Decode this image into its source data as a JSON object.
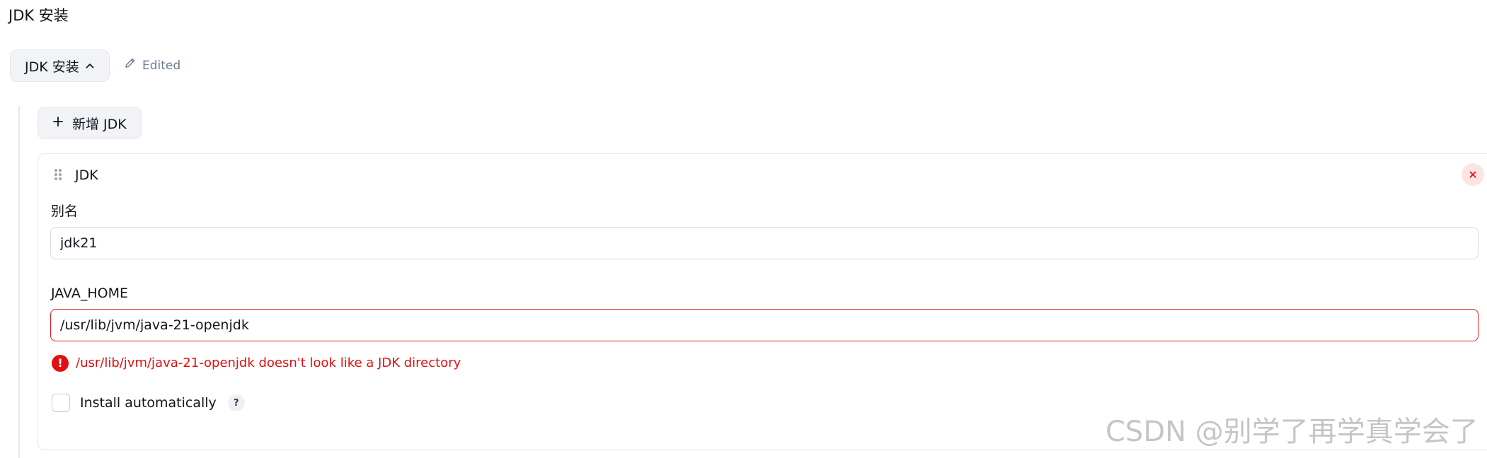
{
  "section": {
    "title": "JDK 安装"
  },
  "toggle": {
    "label": "JDK 安装"
  },
  "status": {
    "edited_label": "Edited"
  },
  "add_button": {
    "label": "新增 JDK"
  },
  "jdk_card": {
    "title": "JDK",
    "alias": {
      "label": "别名",
      "value": "jdk21"
    },
    "java_home": {
      "label": "JAVA_HOME",
      "value": "/usr/lib/jvm/java-21-openjdk",
      "error": "/usr/lib/jvm/java-21-openjdk doesn't look like a JDK directory"
    },
    "install_auto": {
      "label": "Install automatically",
      "checked": false,
      "help": "?"
    }
  },
  "watermark": {
    "text": "CSDN @别学了再学真学会了"
  },
  "colors": {
    "error": "#e10f0f",
    "button_bg": "#f1f3f6",
    "muted": "#6b7a99",
    "delete_bg": "#fde4e4"
  },
  "icons": {
    "toggle": "chevron-up-icon",
    "edited": "pencil-icon",
    "add": "plus-icon",
    "drag": "drag-handle-icon",
    "delete": "close-icon",
    "error": "exclamation-icon"
  }
}
